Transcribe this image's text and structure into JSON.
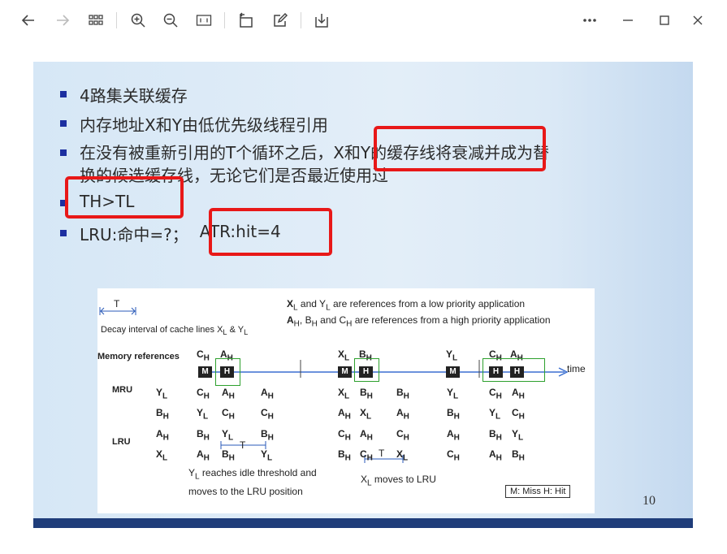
{
  "toolbar": {
    "icons": [
      "back-icon",
      "forward-icon",
      "grid-icon",
      "zoom-in-icon",
      "zoom-out-icon",
      "actual-size-icon",
      "rotate-icon",
      "edit-icon",
      "save-icon",
      "more-icon",
      "minimize-icon",
      "maximize-icon",
      "close-icon"
    ]
  },
  "slide": {
    "bullets": [
      "4路集关联缓存",
      "内存地址X和Y由低优先级线程引用",
      "在没有被重新引用的T个循环之后，X和Y的缓存线将衰减并成为替",
      "换的候选缓存线，无论它们是否最近使用过",
      "TH>TL",
      "LRU:命中=?；",
      "ATR:hit=4"
    ],
    "page_number": "10",
    "accent_color": "#e81818"
  },
  "figure": {
    "t_label": "T",
    "decay_label": "Decay interval of cache lines X",
    "decay_label_tail": " & Y",
    "sub_l": "L",
    "legend_line1": " and Y",
    "legend_line1_tail": " are references from a low priority application",
    "legend_line2_tail": " and C",
    "legend_line2_end": " are references from a high priority application",
    "legend_line2_mid": ", B",
    "memory_refs_label": "Memory references",
    "time_label": "time",
    "mru_label": "MRU",
    "lru_label": "LRU",
    "y_reaches_1": " reaches idle threshold and",
    "y_reaches_2": "moves to the LRU position",
    "x_moves": " moves to LRU",
    "legend_box": "M: Miss   H: Hit",
    "letters": {
      "X": "X",
      "Y": "Y",
      "A": "A",
      "B": "B",
      "C": "C",
      "H": "H",
      "M": "M",
      "sub_h": "H",
      "sub_l": "L"
    }
  }
}
